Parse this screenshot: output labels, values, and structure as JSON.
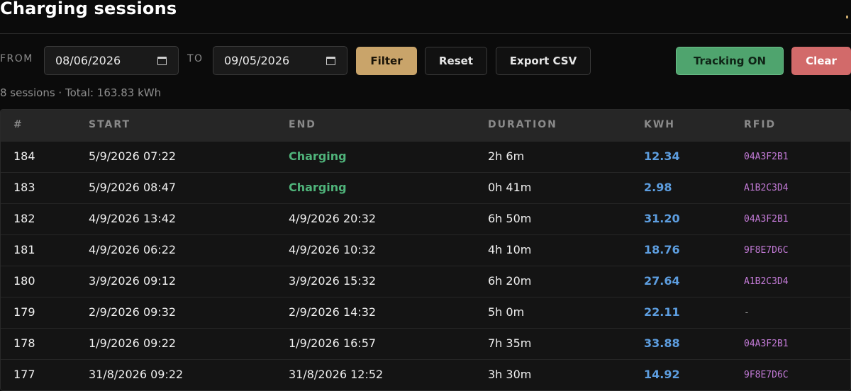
{
  "header": {
    "title": "Charging sessions",
    "accent_color": "#c8a86b"
  },
  "filters": {
    "from_label": "FROM",
    "from_value": "08/06/2026",
    "to_label": "TO",
    "to_value": "09/05/2026",
    "filter_label": "Filter",
    "reset_label": "Reset",
    "export_label": "Export CSV",
    "tracking_label": "Tracking ON",
    "clear_label": "Clear",
    "icons": {
      "calendar": "calendar-icon"
    }
  },
  "summary": "8 sessions · Total: 163.83 kWh",
  "table": {
    "columns": [
      "#",
      "START",
      "END",
      "DURATION",
      "KWH",
      "RFID"
    ],
    "rows": [
      {
        "id": "184",
        "start": "5/9/2026 07:22",
        "end": "Charging",
        "duration": "2h 6m",
        "kwh": "12.34",
        "rfid": "04A3F2B1"
      },
      {
        "id": "183",
        "start": "5/9/2026 08:47",
        "end": "Charging",
        "duration": "0h 41m",
        "kwh": "2.98",
        "rfid": "A1B2C3D4"
      },
      {
        "id": "182",
        "start": "4/9/2026 13:42",
        "end": "4/9/2026 20:32",
        "duration": "6h 50m",
        "kwh": "31.20",
        "rfid": "04A3F2B1"
      },
      {
        "id": "181",
        "start": "4/9/2026 06:22",
        "end": "4/9/2026 10:32",
        "duration": "4h 10m",
        "kwh": "18.76",
        "rfid": "9F8E7D6C"
      },
      {
        "id": "180",
        "start": "3/9/2026 09:12",
        "end": "3/9/2026 15:32",
        "duration": "6h 20m",
        "kwh": "27.64",
        "rfid": "A1B2C3D4"
      },
      {
        "id": "179",
        "start": "2/9/2026 09:32",
        "end": "2/9/2026 14:32",
        "duration": "5h 0m",
        "kwh": "22.11",
        "rfid": "-"
      },
      {
        "id": "178",
        "start": "1/9/2026 09:22",
        "end": "1/9/2026 16:57",
        "duration": "7h 35m",
        "kwh": "33.88",
        "rfid": "04A3F2B1"
      },
      {
        "id": "177",
        "start": "31/8/2026 09:22",
        "end": "31/8/2026 12:52",
        "duration": "3h 30m",
        "kwh": "14.92",
        "rfid": "9F8E7D6C"
      }
    ]
  },
  "colors": {
    "filter_button": "#c9a46a",
    "tracking_button": "#4fa46e",
    "clear_button": "#d26a6a",
    "charging_status": "#4fb37a",
    "kwh_value": "#5d9ee0",
    "rfid_value": "#c27ad6"
  }
}
